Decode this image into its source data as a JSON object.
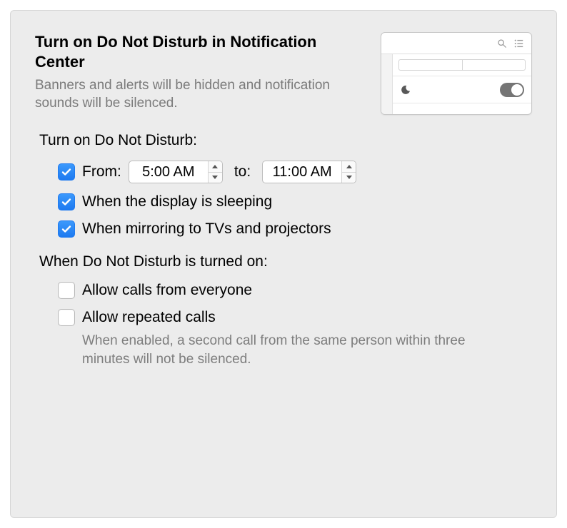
{
  "header": {
    "title": "Turn on Do Not Disturb in Notification Center",
    "subtitle": "Banners and alerts will be hidden and notification sounds will be silenced."
  },
  "schedule": {
    "heading": "Turn on Do Not Disturb:",
    "from_label": "From:",
    "from_value": "5:00 AM",
    "to_label": "to:",
    "to_value": "11:00 AM",
    "display_sleep": "When the display is sleeping",
    "mirroring": "When mirroring to TVs and projectors"
  },
  "when_on": {
    "heading": "When Do Not Disturb is turned on:",
    "allow_everyone": "Allow calls from everyone",
    "allow_repeated": "Allow repeated calls",
    "repeated_note": "When enabled, a second call from the same person within three minutes will not be silenced."
  },
  "checkbox_states": {
    "from_time": true,
    "display_sleep": true,
    "mirroring": true,
    "allow_everyone": false,
    "allow_repeated": false
  }
}
